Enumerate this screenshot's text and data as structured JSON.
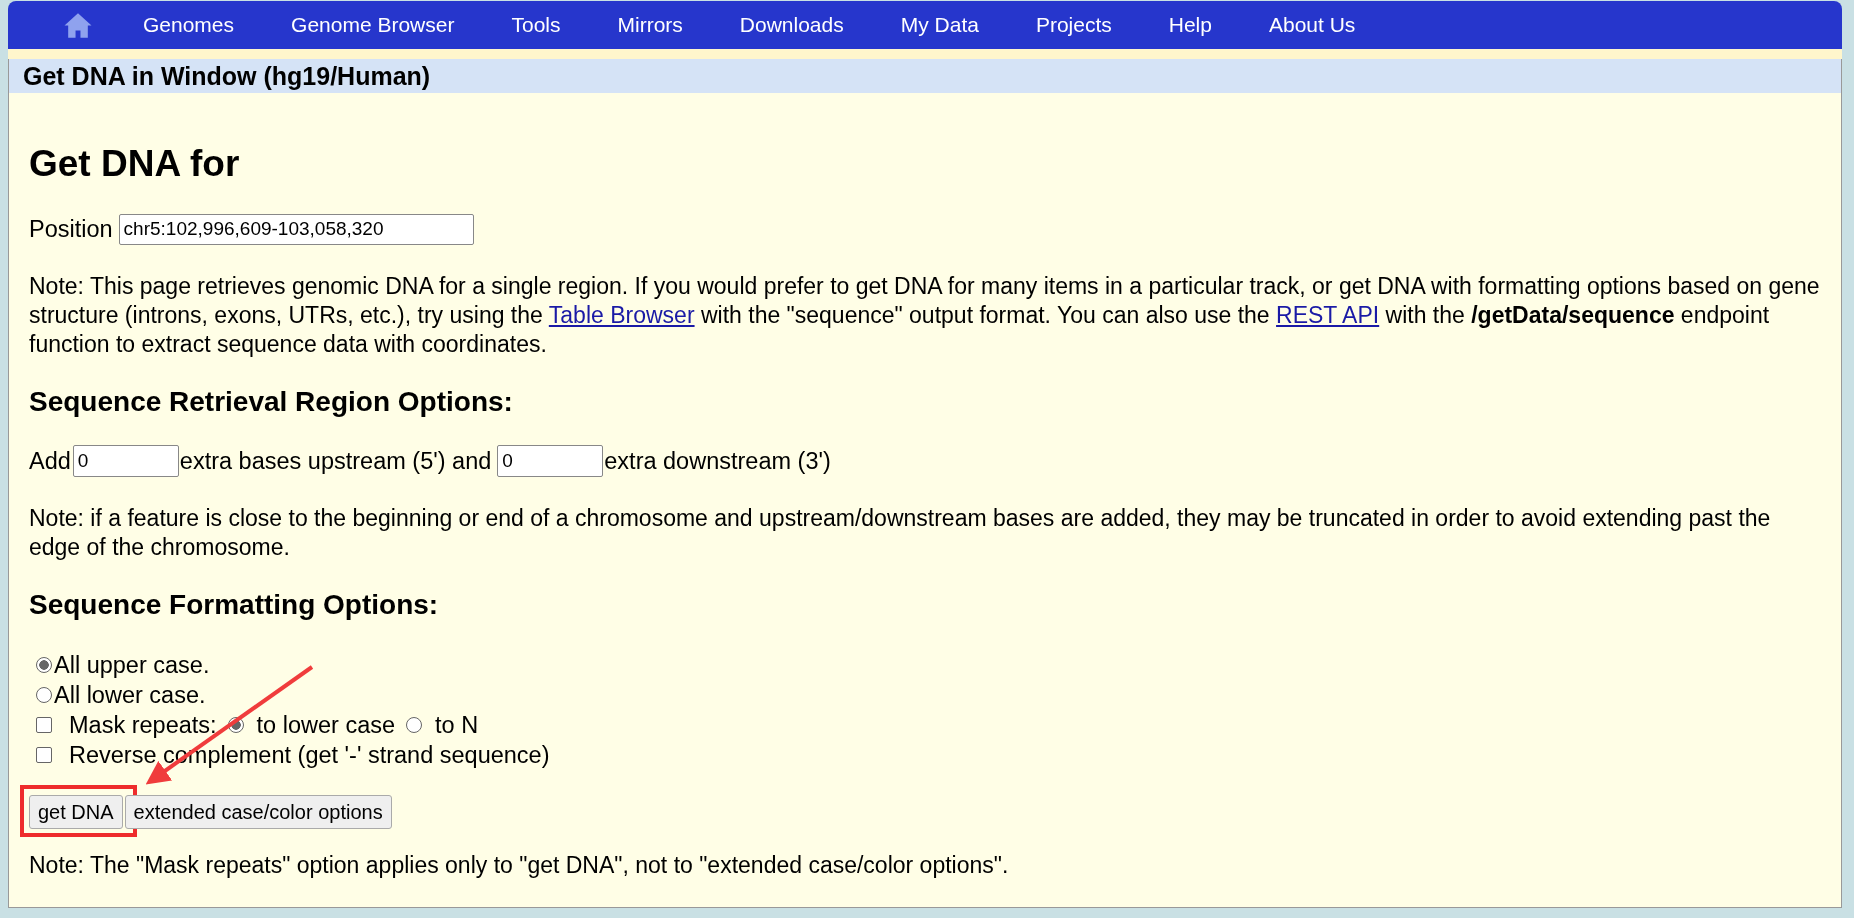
{
  "nav": {
    "items": [
      "Genomes",
      "Genome Browser",
      "Tools",
      "Mirrors",
      "Downloads",
      "My Data",
      "Projects",
      "Help",
      "About Us"
    ]
  },
  "title_bar": {
    "title": "Get DNA in Window (hg19/Human)"
  },
  "heading": "Get DNA for",
  "position": {
    "label": "Position",
    "value": "chr5:102,996,609-103,058,320"
  },
  "note_1": {
    "parts": [
      {
        "kind": "text",
        "text": "Note: This page retrieves genomic DNA for a single region. If you would prefer to get DNA for many items in a particular track, or get DNA with formatting options based on gene structure (introns, exons, UTRs, etc.), try using the "
      },
      {
        "kind": "link",
        "text": "Table Browser"
      },
      {
        "kind": "text",
        "text": " with the \"sequence\" output format. You can also use the "
      },
      {
        "kind": "link",
        "text": "REST API"
      },
      {
        "kind": "text",
        "text": " with the "
      },
      {
        "kind": "bold",
        "text": "/getData/sequence"
      },
      {
        "kind": "text",
        "text": " endpoint function to extract sequence data with coordinates."
      }
    ]
  },
  "region_heading": "Sequence Retrieval Region Options:",
  "region_row": {
    "prefix": "Add",
    "upstream": "0",
    "middle": "extra bases upstream (5') and",
    "downstream": "0",
    "suffix": "extra downstream (3')"
  },
  "note_2": "Note: if a feature is close to the beginning or end of a chromosome and upstream/downstream bases are added, they may be truncated in order to avoid extending past the edge of the chromosome.",
  "format_heading": "Sequence Formatting Options:",
  "case_options": [
    {
      "label": "All upper case.",
      "selected": true
    },
    {
      "label": "All lower case.",
      "selected": false
    }
  ],
  "mask_repeats": {
    "label": "Mask repeats:",
    "checked": false,
    "options": [
      {
        "label": "to lower case",
        "selected": true
      },
      {
        "label": "to N",
        "selected": false
      }
    ]
  },
  "reverse_complement": {
    "label": "Reverse complement (get '-' strand sequence)",
    "checked": false
  },
  "buttons": [
    {
      "label": "get DNA",
      "highlighted": true
    },
    {
      "label": "extended case/color options",
      "highlighted": false
    }
  ],
  "note_3": "Note: The \"Mask repeats\" option applies only to \"get DNA\", not to \"extended case/color options\"."
}
